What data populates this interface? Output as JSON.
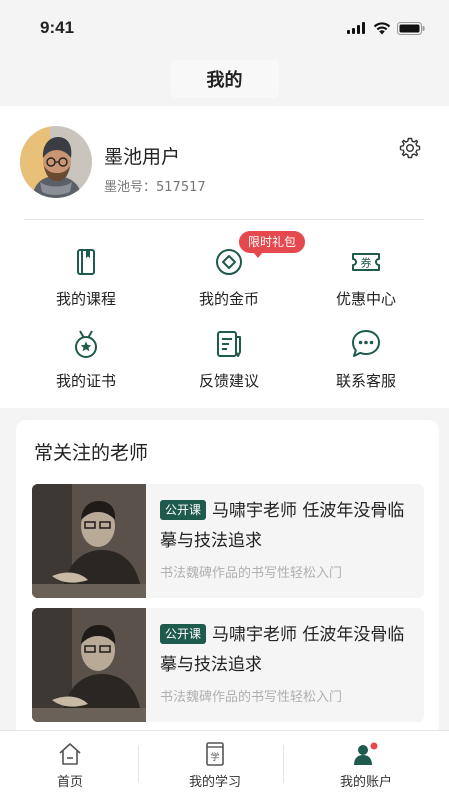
{
  "status_bar": {
    "time": "9:41"
  },
  "nav": {
    "title": "我的"
  },
  "profile": {
    "name": "墨池用户",
    "id_label": "墨池号：517517"
  },
  "grid": {
    "courses": "我的课程",
    "coins": "我的金币",
    "coins_badge": "限时礼包",
    "coupons": "优惠中心",
    "coupon_icon_text": "券",
    "certificates": "我的证书",
    "feedback": "反馈建议",
    "support": "联系客服"
  },
  "teachers": {
    "title": "常关注的老师",
    "items": [
      {
        "tag": "公开课",
        "title": "马啸宇老师 任波年没骨临摹与技法追求",
        "subtitle": "书法魏碑作品的书写性轻松入门"
      },
      {
        "tag": "公开课",
        "title": "马啸宇老师 任波年没骨临摹与技法追求",
        "subtitle": "书法魏碑作品的书写性轻松入门"
      }
    ]
  },
  "tabs": {
    "home": "首页",
    "study": "我的学习",
    "study_icon_text": "学",
    "account": "我的账户"
  },
  "colors": {
    "accent": "#1e5a4d",
    "badge": "#e5484d"
  }
}
